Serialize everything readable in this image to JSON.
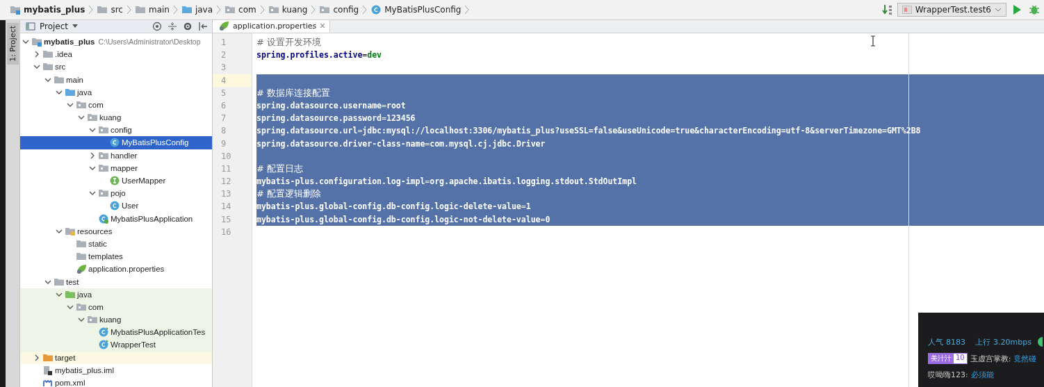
{
  "breadcrumbs": [
    {
      "label": "mybatis_plus",
      "kind": "module"
    },
    {
      "label": "src",
      "kind": "folder"
    },
    {
      "label": "main",
      "kind": "folder"
    },
    {
      "label": "java",
      "kind": "folder-blue"
    },
    {
      "label": "com",
      "kind": "package"
    },
    {
      "label": "kuang",
      "kind": "package"
    },
    {
      "label": "config",
      "kind": "package"
    },
    {
      "label": "MyBatisPlusConfig",
      "kind": "class"
    }
  ],
  "run_config": {
    "label": "WrapperTest.test6"
  },
  "side_stripe": {
    "label": "1: Project"
  },
  "project_panel": {
    "title": "Project",
    "tree": [
      {
        "label": "mybatis_plus",
        "path": "C:\\Users\\Administrator\\Desktop",
        "kind": "module",
        "expanded": true,
        "selected": false,
        "children": [
          {
            "label": ".idea",
            "kind": "folder",
            "expanded": false,
            "selected": false
          },
          {
            "label": "src",
            "kind": "folder",
            "expanded": true,
            "selected": false,
            "children": [
              {
                "label": "main",
                "kind": "folder",
                "expanded": true,
                "selected": false,
                "children": [
                  {
                    "label": "java",
                    "kind": "folder-blue",
                    "expanded": true,
                    "selected": false,
                    "children": [
                      {
                        "label": "com",
                        "kind": "package",
                        "expanded": true,
                        "selected": false,
                        "children": [
                          {
                            "label": "kuang",
                            "kind": "package",
                            "expanded": true,
                            "selected": false,
                            "children": [
                              {
                                "label": "config",
                                "kind": "package",
                                "expanded": true,
                                "selected": false,
                                "children": [
                                  {
                                    "label": "MyBatisPlusConfig",
                                    "kind": "class",
                                    "selected": true
                                  }
                                ]
                              },
                              {
                                "label": "handler",
                                "kind": "package",
                                "expanded": false,
                                "selected": false
                              },
                              {
                                "label": "mapper",
                                "kind": "package",
                                "expanded": true,
                                "selected": false,
                                "children": [
                                  {
                                    "label": "UserMapper",
                                    "kind": "interface",
                                    "selected": false
                                  }
                                ]
                              },
                              {
                                "label": "pojo",
                                "kind": "package",
                                "expanded": true,
                                "selected": false,
                                "children": [
                                  {
                                    "label": "User",
                                    "kind": "class",
                                    "selected": false
                                  }
                                ]
                              },
                              {
                                "label": "MybatisPlusApplication",
                                "kind": "spring-class",
                                "selected": false
                              }
                            ]
                          }
                        ]
                      }
                    ]
                  },
                  {
                    "label": "resources",
                    "kind": "folder-res",
                    "expanded": true,
                    "selected": false,
                    "children": [
                      {
                        "label": "static",
                        "kind": "folder",
                        "selected": false
                      },
                      {
                        "label": "templates",
                        "kind": "folder",
                        "selected": false
                      },
                      {
                        "label": "application.properties",
                        "kind": "spring",
                        "selected": false
                      }
                    ]
                  }
                ]
              },
              {
                "label": "test",
                "kind": "folder",
                "expanded": true,
                "selected": false,
                "children": [
                  {
                    "label": "java",
                    "kind": "folder-green",
                    "expanded": true,
                    "selected": false,
                    "test_source": true,
                    "children": [
                      {
                        "label": "com",
                        "kind": "package",
                        "expanded": true,
                        "selected": false,
                        "test_source": true,
                        "children": [
                          {
                            "label": "kuang",
                            "kind": "package",
                            "expanded": true,
                            "selected": false,
                            "test_source": true,
                            "children": [
                              {
                                "label": "MybatisPlusApplicationTes",
                                "kind": "test-class",
                                "selected": false,
                                "test_source": true
                              },
                              {
                                "label": "WrapperTest",
                                "kind": "test-class",
                                "selected": false,
                                "test_source": true
                              }
                            ]
                          }
                        ]
                      }
                    ]
                  }
                ]
              }
            ]
          },
          {
            "label": "target",
            "kind": "folder-orange",
            "expanded": false,
            "selected": false,
            "excluded": true
          },
          {
            "label": "mybatis_plus.iml",
            "kind": "iml",
            "selected": false
          },
          {
            "label": "pom.xml",
            "kind": "maven",
            "selected": false
          }
        ]
      }
    ]
  },
  "editor": {
    "tabs": [
      {
        "label": "application.properties",
        "selected": true
      }
    ],
    "lines": [
      {
        "number": "1",
        "kind": "comment",
        "text": "# 设置开发环境",
        "selected": false
      },
      {
        "number": "2",
        "kind": "property",
        "text": "spring.profiles.active=dev",
        "selected": false
      },
      {
        "number": "3",
        "kind": "blank",
        "selected": false
      },
      {
        "number": "4",
        "kind": "blank",
        "selected": true,
        "current": true
      },
      {
        "number": "5",
        "kind": "comment",
        "text": "# 数据库连接配置",
        "selected": true
      },
      {
        "number": "6",
        "kind": "property",
        "text": "spring.datasource.username=root",
        "selected": true
      },
      {
        "number": "7",
        "kind": "property",
        "text": "spring.datasource.password=123456",
        "selected": true
      },
      {
        "number": "8",
        "kind": "property",
        "text": "spring.datasource.url=jdbc:mysql://localhost:3306/mybatis_plus?useSSL=false&useUnicode=true&characterEncoding=utf-8&serverTimezone=GMT%2B8",
        "selected": true
      },
      {
        "number": "9",
        "kind": "property",
        "text": "spring.datasource.driver-class-name=com.mysql.cj.jdbc.Driver",
        "selected": true
      },
      {
        "number": "10",
        "kind": "blank",
        "selected": true
      },
      {
        "number": "11",
        "kind": "comment",
        "text": "# 配置日志",
        "selected": true
      },
      {
        "number": "12",
        "kind": "property",
        "text": "mybatis-plus.configuration.log-impl=org.apache.ibatis.logging.stdout.StdOutImpl",
        "selected": true
      },
      {
        "number": "13",
        "kind": "comment",
        "text": "# 配置逻辑删除",
        "selected": true
      },
      {
        "number": "14",
        "kind": "property",
        "text": "mybatis-plus.global-config.db-config.logic-delete-value=1",
        "selected": true
      },
      {
        "number": "15",
        "kind": "property",
        "text": "mybatis-plus.global-config.db-config.logic-not-delete-value=0",
        "selected": true
      },
      {
        "number": "16",
        "kind": "blank",
        "selected": false
      }
    ]
  },
  "stream_overlay": {
    "popularity_label": "人气",
    "popularity": "8183",
    "upload_label": "上行",
    "upload": "3.20mbps",
    "messages": [
      {
        "badge": "美汁汁",
        "badge_level": "10",
        "user": "玉虚宫掌教:",
        "text": "竟然碰"
      },
      {
        "user": "哎呦嗨123:",
        "text": "必须能"
      }
    ]
  }
}
